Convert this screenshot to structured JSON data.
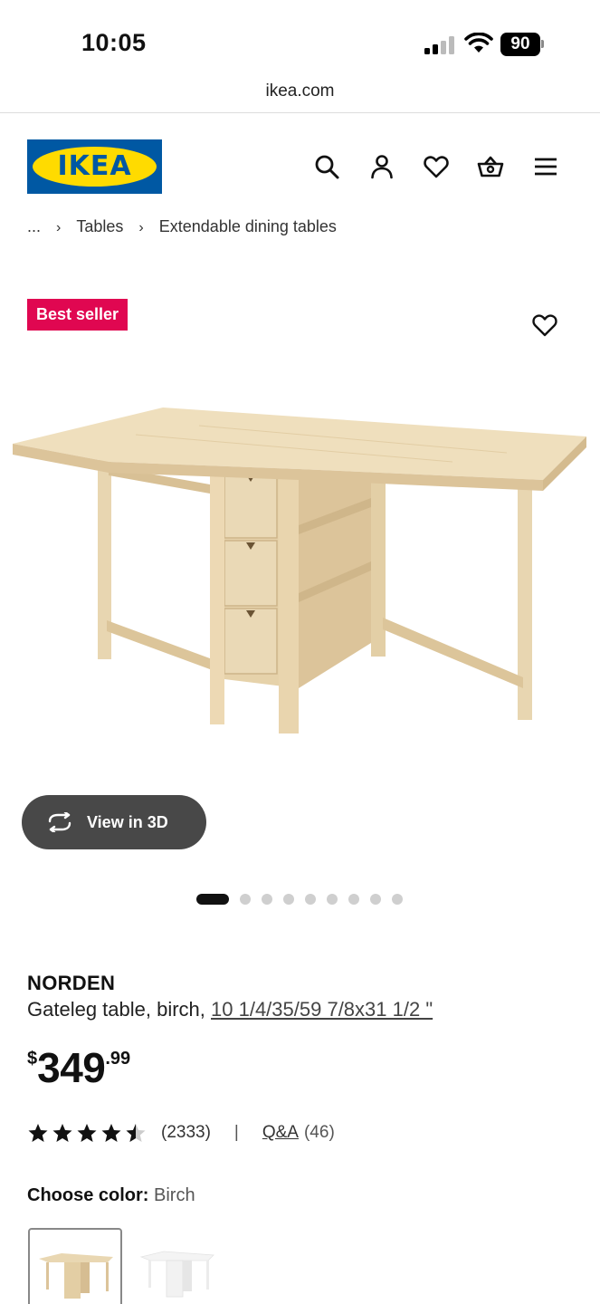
{
  "status": {
    "time": "10:05",
    "battery": "90"
  },
  "browser": {
    "url": "ikea.com"
  },
  "header": {
    "logo_text": "IKEA"
  },
  "breadcrumb": {
    "ellipsis": "...",
    "items": [
      "Tables",
      "Extendable dining tables"
    ]
  },
  "badge": "Best seller",
  "view3d": {
    "label": "View in 3D"
  },
  "carousel": {
    "count": 9,
    "active": 0
  },
  "product": {
    "name": "NORDEN",
    "description": "Gateleg table, birch, ",
    "dimensions": "10 1/4/35/59 7/8x31 1/2 \"",
    "price": {
      "currency": "$",
      "main": "349",
      "cents": ".99"
    }
  },
  "rating": {
    "stars": 4.5,
    "count": "(2333)",
    "separator": "|",
    "qa_label": "Q&A",
    "qa_count": "(46)"
  },
  "color_choice": {
    "label": "Choose color:",
    "value": "Birch"
  },
  "colors": {
    "birch": "#e6d3ae",
    "white": "#f7f7f7",
    "badge": "#e00751",
    "logo_blue": "#0058a3",
    "logo_yellow": "#ffdb00"
  }
}
